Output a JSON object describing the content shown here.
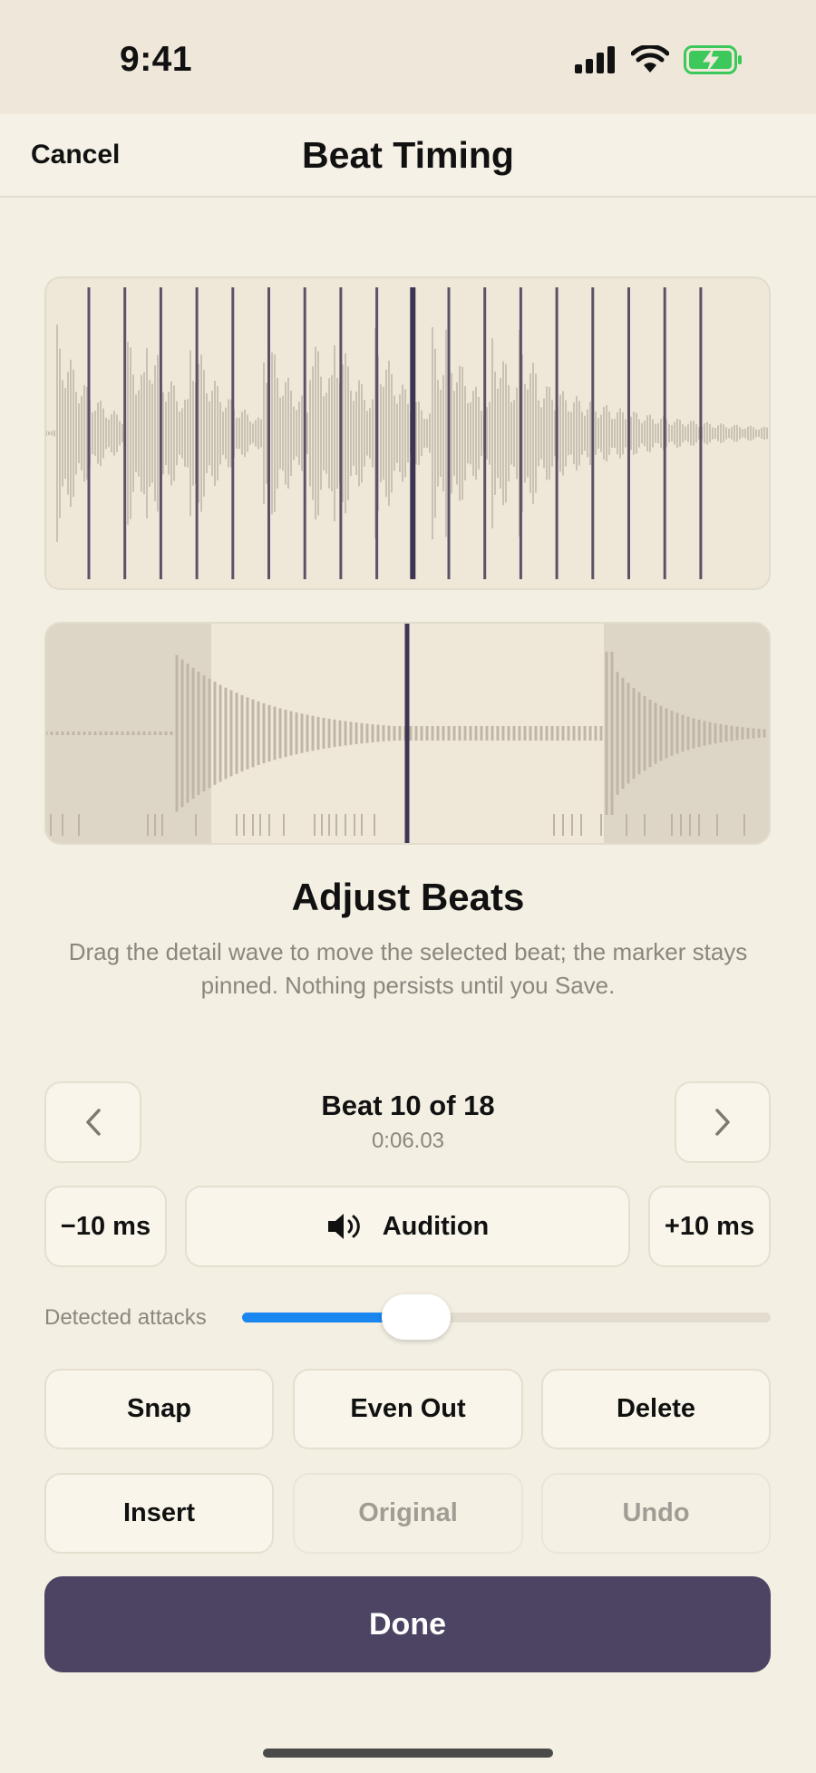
{
  "status_bar": {
    "time": "9:41",
    "icons": [
      "signal-icon",
      "wifi-icon",
      "battery-charging-icon"
    ],
    "battery_color": "#3cc85a"
  },
  "nav": {
    "cancel_label": "Cancel",
    "title": "Beat Timing"
  },
  "waveforms": {
    "overview_beat_count": 18,
    "selected_beat_index": 10,
    "marker_color": "#5a5368",
    "selected_marker_color": "#3d3552"
  },
  "section": {
    "heading": "Adjust Beats",
    "description": "Drag the detail wave to move the selected beat; the marker stays pinned. Nothing persists until you Save."
  },
  "beat_nav": {
    "prev_icon": "chevron-left-icon",
    "next_icon": "chevron-right-icon",
    "label": "Beat 10 of 18",
    "time": "0:06.03"
  },
  "nudge": {
    "minus_label": "−10 ms",
    "audition_label": "Audition",
    "audition_icon": "speaker-icon",
    "plus_label": "+10 ms"
  },
  "slider": {
    "label": "Detected attacks",
    "value": 0.33,
    "accent": "#1a86f0"
  },
  "actions": {
    "snap": "Snap",
    "even_out": "Even Out",
    "delete": "Delete",
    "insert": "Insert",
    "original": "Original",
    "undo": "Undo"
  },
  "done_label": "Done",
  "colors": {
    "background": "#f4efe3",
    "primary_button": "#4d4463"
  }
}
